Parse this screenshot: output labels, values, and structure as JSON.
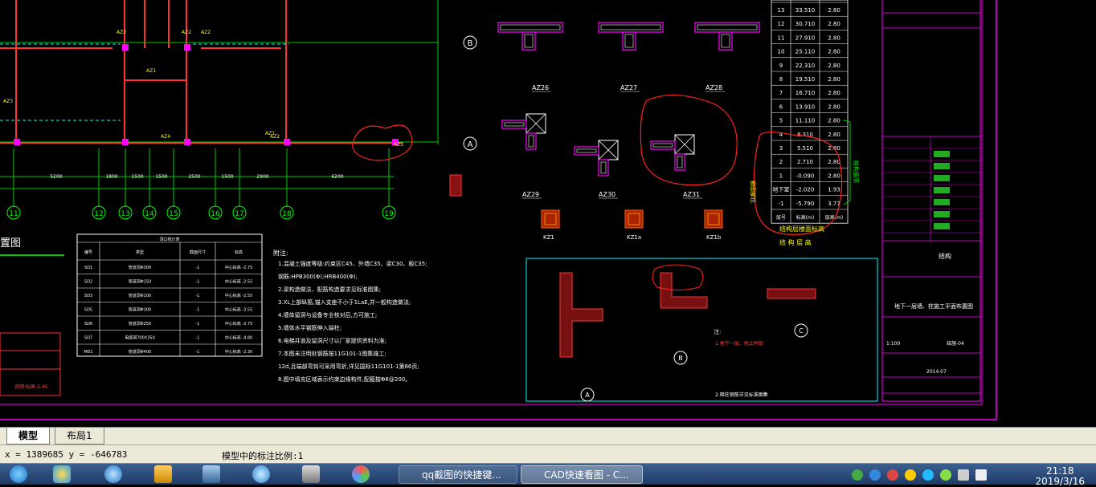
{
  "drawing": {
    "axes_left": [
      "11",
      "12",
      "13",
      "14",
      "15",
      "16",
      "17",
      "18",
      "19"
    ],
    "axes_right": [
      "B",
      "A"
    ],
    "dims": [
      "5200",
      "1800",
      "1500",
      "1500",
      "2500",
      "1500",
      "2900",
      "6200"
    ],
    "plan_title": "置图",
    "labels_az": [
      "AZ26",
      "AZ27",
      "AZ28",
      "AZ29",
      "AZ30",
      "AZ31"
    ],
    "labels_kz": [
      "KZ1",
      "KZ1a",
      "KZ1b"
    ],
    "plan_labels": [
      "AZ3",
      "AZ2",
      "AZ2",
      "AZ1",
      "AZ4",
      "AZ2",
      "AZ1",
      "AZ2",
      "AZ3"
    ],
    "legend_title": "结构层楼面标高",
    "legend_sub": "结 构 层 高",
    "detail_marks": [
      "A",
      "B",
      "C"
    ]
  },
  "elevation_table": {
    "rows": [
      [
        "13",
        "33.510",
        "2.80"
      ],
      [
        "12",
        "30.710",
        "2.80"
      ],
      [
        "11",
        "27.910",
        "2.80"
      ],
      [
        "10",
        "25.110",
        "2.80"
      ],
      [
        "9",
        "22.310",
        "2.80"
      ],
      [
        "8",
        "19.510",
        "2.80"
      ],
      [
        "7",
        "16.710",
        "2.80"
      ],
      [
        "6",
        "13.910",
        "2.80"
      ],
      [
        "5",
        "11.110",
        "2.80"
      ],
      [
        "4",
        "8.310",
        "2.80"
      ],
      [
        "3",
        "5.510",
        "2.80"
      ],
      [
        "2",
        "2.710",
        "2.80"
      ],
      [
        "1",
        "-0.090",
        "2.80"
      ],
      [
        "地下室",
        "-2.020",
        "1.93"
      ],
      [
        "-1",
        "-5.790",
        "3.77"
      ]
    ],
    "footer": [
      "层号",
      "标高(m)",
      "层高(m)"
    ]
  },
  "notes": {
    "title": "附注:",
    "lines": [
      "1.混凝土强度等级:约束区C45、外墙C35、梁C30、板C35;",
      "钢筋:HPB300(Φ);HRB400(Φ);",
      "2.梁构造做法、配筋构造要求见标准图集;",
      "3.XL上部纵筋,锚入支座不小于1LaE,并一般构造做法;",
      "4.墙体留洞与设备专业核对后,方可施工;",
      "5.墙体水平钢筋伸入端柱;",
      "6.电梯井道及留洞尺寸以厂家提供资料为准;",
      "7.本图未注明处钢筋按11G101-1图集施工;",
      "12d,且端部弯钩可采用弯折,详见国标11G101-1第86页;",
      "8.图中填充区域表示约束边缘构件,配箍按Φ8@200。"
    ]
  },
  "left_table": {
    "header": [
      "编号",
      "类型",
      "截面尺寸",
      "标高"
    ],
    "rows": [
      [
        "SD1",
        "管道洞Φ300",
        "-1",
        "中心标高 -2.75"
      ],
      [
        "SD2",
        "管道洞Φ150",
        "-1",
        "中心标高 -2.55"
      ],
      [
        "SD3",
        "管道洞Φ100",
        "-1",
        "中心标高 -2.55"
      ],
      [
        "SD5",
        "管道洞Φ300",
        "-1",
        "中心标高 -3.55"
      ],
      [
        "SD6",
        "管道洞Φ250",
        "-1",
        "中心标高 -2.75"
      ],
      [
        "SD7",
        "电缆洞700X350",
        "-1",
        "中心标高 -4.80"
      ],
      [
        "MD1",
        "管道洞Φ400",
        "-1",
        "中心标高 -2.30"
      ]
    ]
  },
  "detail_note": {
    "title": "注:",
    "line1": "1.地下一层、地上同层",
    "line2": "2.暗柱钢筋详见标准图集"
  },
  "titleblock": {
    "project": "结构",
    "drawing_name": "地下一层墙、柱施工平面布置图",
    "number": "结施-04",
    "date": "2014.07",
    "scale": "1:100"
  },
  "tabs": {
    "model": "模型",
    "layout1": "布局1"
  },
  "status": {
    "coords": "x = 1389685  y = -646783",
    "scale_text": "模型中的标注比例:1"
  },
  "taskbar": {
    "task1": "qq截图的快捷键...",
    "task2": "CAD快速看图 - C...",
    "time": "21:18",
    "date": "2019/3/16"
  }
}
